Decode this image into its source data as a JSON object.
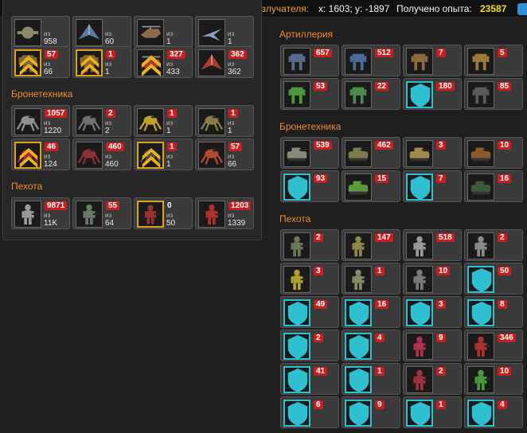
{
  "topbar": {
    "coords_label": "Координаты Излучателя:",
    "coords_value": "x: 1603; y: -1897",
    "exp_label": "Получено опыта:",
    "exp_value": "23587"
  },
  "colors": {
    "accent": "#f08a2a",
    "count_badge": "#c81e1e",
    "exp": "#f5e000",
    "gold_frame": "#e0a020",
    "cyan_frame": "#2ec0d0"
  },
  "left": {
    "sections": [
      {
        "title": "",
        "cards": [
          {
            "count": "",
            "of": "из",
            "total": "958",
            "frame": "none",
            "icon": "drone-icon",
            "c": "#8a8a6a"
          },
          {
            "count": "",
            "of": "из",
            "total": "60",
            "frame": "none",
            "icon": "fighter-icon",
            "c": "#5a7aa0"
          },
          {
            "count": "",
            "of": "из",
            "total": "1",
            "frame": "none",
            "icon": "gunship-icon",
            "c": "#8a6a4a"
          },
          {
            "count": "",
            "of": "из",
            "total": "1",
            "frame": "none",
            "icon": "jet-icon",
            "c": "#8aa0c0"
          },
          {
            "count": "57",
            "of": "из",
            "total": "66",
            "frame": "gold",
            "icon": "mech-icon",
            "c": "#7a6a3a",
            "rank": true
          },
          {
            "count": "1",
            "of": "из",
            "total": "1",
            "frame": "gold",
            "icon": "mech-icon",
            "c": "#8a6a2a",
            "rank": true
          },
          {
            "count": "327",
            "of": "из",
            "total": "433",
            "frame": "none",
            "icon": "gunship-icon",
            "c": "#a04030",
            "rank": true
          },
          {
            "count": "362",
            "of": "из",
            "total": "362",
            "frame": "none",
            "icon": "fighter-icon",
            "c": "#b03a2a"
          }
        ]
      },
      {
        "title": "Бронетехника",
        "cards": [
          {
            "count": "1057",
            "of": "из",
            "total": "1220",
            "frame": "none",
            "icon": "spider-tank-icon",
            "c": "#909090"
          },
          {
            "count": "2",
            "of": "из",
            "total": "2",
            "frame": "none",
            "icon": "spider-tank-icon",
            "c": "#707070"
          },
          {
            "count": "1",
            "of": "из",
            "total": "1",
            "frame": "none",
            "icon": "spider-tank-icon",
            "c": "#c0a030"
          },
          {
            "count": "1",
            "of": "из",
            "total": "1",
            "frame": "none",
            "icon": "spider-tank-icon",
            "c": "#8a7a4a"
          },
          {
            "count": "46",
            "of": "из",
            "total": "124",
            "frame": "gold",
            "icon": "spider-tank-icon",
            "c": "#a03030",
            "rank": true
          },
          {
            "count": "460",
            "of": "из",
            "total": "460",
            "frame": "none",
            "icon": "spider-tank-icon",
            "c": "#903030"
          },
          {
            "count": "1",
            "of": "из",
            "total": "1",
            "frame": "gold",
            "icon": "spider-tank-icon",
            "c": "#505050",
            "rank": true
          },
          {
            "count": "57",
            "of": "из",
            "total": "66",
            "frame": "none",
            "icon": "spider-tank-icon",
            "c": "#b04a30"
          }
        ]
      },
      {
        "title": "Пехота",
        "cards": [
          {
            "count": "9871",
            "of": "из",
            "total": "11K",
            "frame": "none",
            "icon": "soldier-icon",
            "c": "#9a9a9a"
          },
          {
            "count": "55",
            "of": "из",
            "total": "64",
            "frame": "none",
            "icon": "soldier-icon",
            "c": "#6a7a6a"
          },
          {
            "count": "0",
            "of": "из",
            "total": "50",
            "frame": "gold",
            "icon": "soldier-icon",
            "c": "#a03030",
            "plain": true
          },
          {
            "count": "1203",
            "of": "из",
            "total": "1339",
            "frame": "none",
            "icon": "soldier-icon",
            "c": "#b03030"
          }
        ]
      }
    ]
  },
  "right": {
    "sections": [
      {
        "title": "Артиллерия",
        "cards": [
          {
            "count": "657",
            "frame": "none",
            "icon": "walker-icon",
            "c": "#5a6a8a"
          },
          {
            "count": "512",
            "frame": "none",
            "icon": "walker-icon",
            "c": "#4a6a9a"
          },
          {
            "count": "7",
            "frame": "none",
            "icon": "walker-icon",
            "c": "#8a6a3a"
          },
          {
            "count": "5",
            "frame": "none",
            "icon": "walker-icon",
            "c": "#9a7a3a"
          },
          {
            "count": "53",
            "frame": "none",
            "icon": "walker-icon",
            "c": "#4a9a3a"
          },
          {
            "count": "22",
            "frame": "none",
            "icon": "walker-icon",
            "c": "#4a8a4a"
          },
          {
            "count": "180",
            "frame": "cyan",
            "icon": "walker-icon",
            "c": "#9a3a3a",
            "shield": true
          },
          {
            "count": "85",
            "frame": "none",
            "icon": "walker-icon",
            "c": "#5a5a5a"
          }
        ]
      },
      {
        "title": "Бронетехника",
        "cards": [
          {
            "count": "539",
            "frame": "none",
            "icon": "tank-icon",
            "c": "#8a8a7a"
          },
          {
            "count": "462",
            "frame": "none",
            "icon": "tank-icon",
            "c": "#7a7a4a"
          },
          {
            "count": "3",
            "frame": "none",
            "icon": "tank-icon",
            "c": "#a08a4a"
          },
          {
            "count": "10",
            "frame": "none",
            "icon": "tank-icon",
            "c": "#8a5a2a"
          },
          {
            "count": "93",
            "frame": "cyan",
            "icon": "tank-icon",
            "c": "#8a4a2a",
            "shield": true
          },
          {
            "count": "15",
            "frame": "none",
            "icon": "tank-icon",
            "c": "#5a9a3a"
          },
          {
            "count": "7",
            "frame": "cyan",
            "icon": "tank-icon",
            "c": "#3a6a3a",
            "shield": true
          },
          {
            "count": "16",
            "frame": "none",
            "icon": "tank-icon",
            "c": "#3a5a3a"
          }
        ]
      },
      {
        "title": "Пехота",
        "cards": [
          {
            "count": "2",
            "frame": "none",
            "icon": "soldier-icon",
            "c": "#6a7a5a"
          },
          {
            "count": "147",
            "frame": "none",
            "icon": "soldier-icon",
            "c": "#8a8a4a"
          },
          {
            "count": "518",
            "frame": "none",
            "icon": "soldier-icon",
            "c": "#9a9a9a"
          },
          {
            "count": "2",
            "frame": "none",
            "icon": "soldier-icon",
            "c": "#8a8a8a"
          },
          {
            "count": "3",
            "frame": "none",
            "icon": "soldier-icon",
            "c": "#b0a030"
          },
          {
            "count": "1",
            "frame": "none",
            "icon": "soldier-icon",
            "c": "#8a8a6a"
          },
          {
            "count": "10",
            "frame": "none",
            "icon": "soldier-icon",
            "c": "#7a7a7a"
          },
          {
            "count": "50",
            "frame": "cyan",
            "icon": "soldier-icon",
            "c": "#6a6a3a",
            "shield": true
          },
          {
            "count": "49",
            "frame": "cyan",
            "icon": "soldier-icon",
            "c": "#5a6a4a",
            "shield": true
          },
          {
            "count": "16",
            "frame": "cyan",
            "icon": "soldier-icon",
            "c": "#a05a4a",
            "shield": true
          },
          {
            "count": "3",
            "frame": "cyan",
            "icon": "soldier-icon",
            "c": "#8a6a3a",
            "shield": true
          },
          {
            "count": "8",
            "frame": "cyan",
            "icon": "soldier-icon",
            "c": "#5a7a5a",
            "shield": true
          },
          {
            "count": "2",
            "frame": "cyan",
            "icon": "soldier-icon",
            "c": "#c0a030",
            "shield": true
          },
          {
            "count": "4",
            "frame": "cyan",
            "icon": "soldier-icon",
            "c": "#b09030",
            "shield": true
          },
          {
            "count": "9",
            "frame": "none",
            "icon": "soldier-icon",
            "c": "#b03050"
          },
          {
            "count": "346",
            "frame": "none",
            "icon": "soldier-icon",
            "c": "#b03030"
          },
          {
            "count": "41",
            "frame": "cyan",
            "icon": "soldier-icon",
            "c": "#5a7a4a",
            "shield": true
          },
          {
            "count": "1",
            "frame": "cyan",
            "icon": "soldier-icon",
            "c": "#b09030",
            "shield": true
          },
          {
            "count": "2",
            "frame": "none",
            "icon": "soldier-icon",
            "c": "#a03040"
          },
          {
            "count": "10",
            "frame": "none",
            "icon": "soldier-icon",
            "c": "#4a9a3a"
          },
          {
            "count": "6",
            "frame": "cyan",
            "icon": "soldier-icon",
            "c": "#4a9a3a",
            "shield": true
          },
          {
            "count": "9",
            "frame": "cyan",
            "icon": "soldier-icon",
            "c": "#3a8a4a",
            "shield": true
          },
          {
            "count": "1",
            "frame": "cyan",
            "icon": "soldier-icon",
            "c": "#4a7a5a",
            "shield": true
          },
          {
            "count": "4",
            "frame": "cyan",
            "icon": "soldier-icon",
            "c": "#5a8a5a",
            "shield": true
          }
        ]
      }
    ]
  }
}
